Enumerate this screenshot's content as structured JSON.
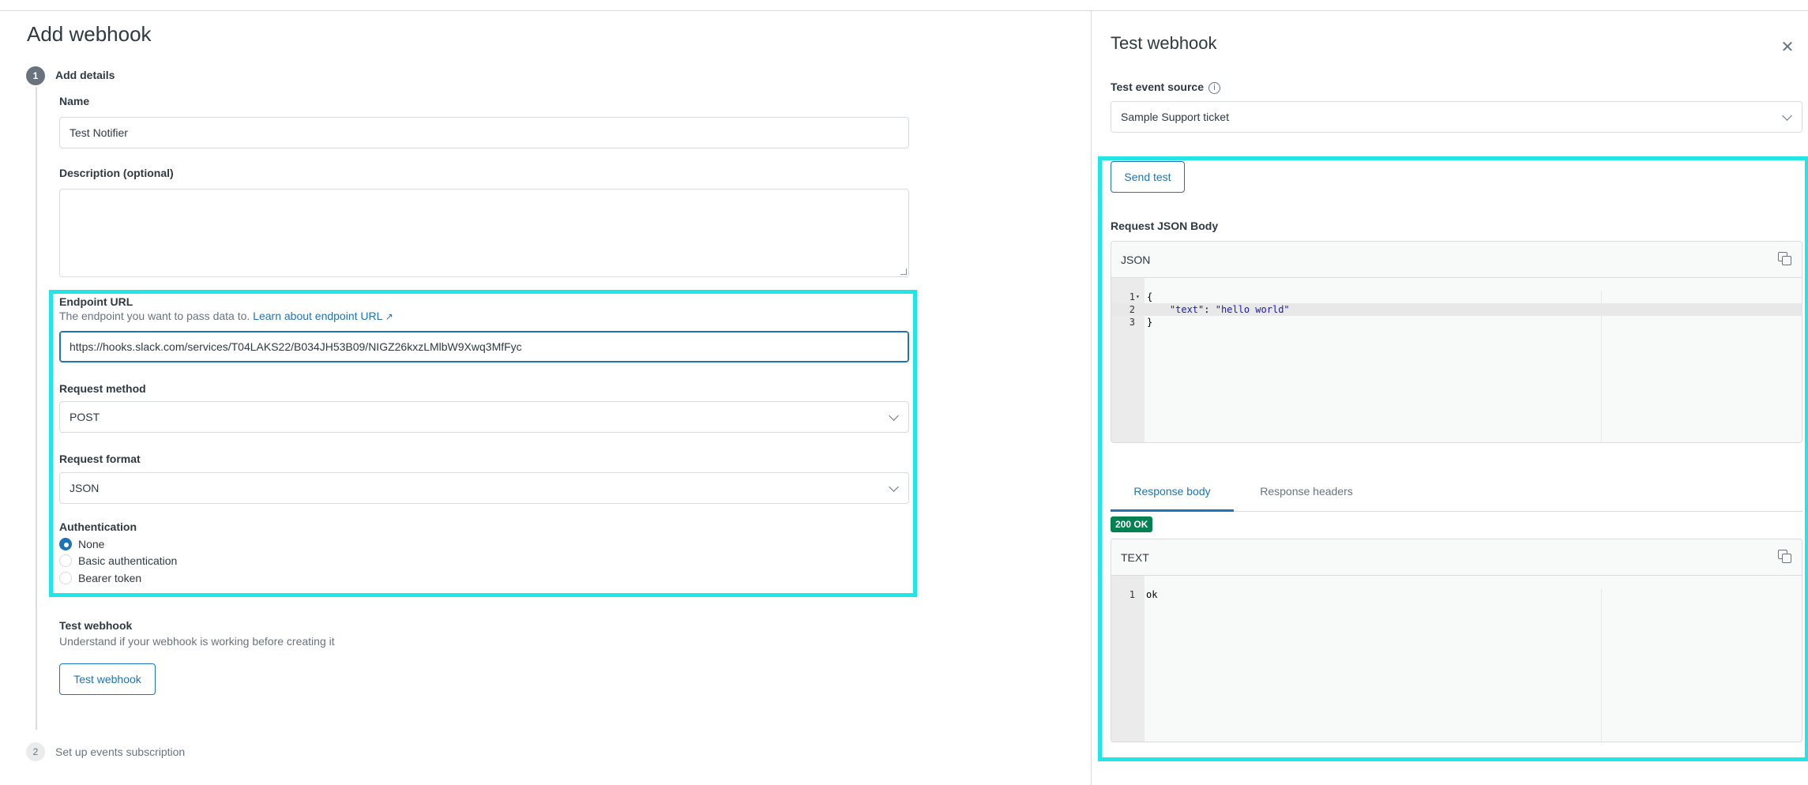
{
  "page": {
    "title": "Add webhook"
  },
  "steps": [
    {
      "number": "1",
      "label": "Add details"
    },
    {
      "number": "2",
      "label": "Set up events subscription"
    }
  ],
  "form": {
    "name_label": "Name",
    "name_value": "Test Notifier",
    "description_label": "Description (optional)",
    "description_value": "",
    "endpoint_label": "Endpoint URL",
    "endpoint_hint": "The endpoint you want to pass data to.",
    "endpoint_link": "Learn about endpoint URL",
    "endpoint_value": "https://hooks.slack.com/services/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",
    "method_label": "Request method",
    "method_value": "POST",
    "format_label": "Request format",
    "format_value": "JSON",
    "auth_label": "Authentication",
    "auth_options": [
      {
        "label": "None",
        "checked": true
      },
      {
        "label": "Basic authentication",
        "checked": false
      },
      {
        "label": "Bearer token",
        "checked": false
      }
    ],
    "test_title": "Test webhook",
    "test_hint": "Understand if your webhook is working before creating it",
    "test_button": "Test webhook"
  },
  "panel": {
    "title": "Test webhook",
    "close_icon": "close-icon",
    "source_label": "Test event source",
    "source_value": "Sample Support ticket",
    "send_button": "Send test",
    "request_label": "Request JSON Body",
    "request_format": "JSON",
    "request_lines": [
      {
        "n": "1",
        "text": "{"
      },
      {
        "n": "2",
        "key": "\"text\"",
        "sep": ": ",
        "val": "\"hello world\""
      },
      {
        "n": "3",
        "text": "}"
      }
    ],
    "tabs": [
      "Response body",
      "Response headers"
    ],
    "active_tab": "Response body",
    "status_badge": "200 OK",
    "response_format": "TEXT",
    "response_lines": [
      {
        "n": "1",
        "text": "ok"
      }
    ]
  },
  "colors": {
    "accent": "#1f73b7",
    "highlight": "#22e5e5",
    "success": "#038153"
  }
}
